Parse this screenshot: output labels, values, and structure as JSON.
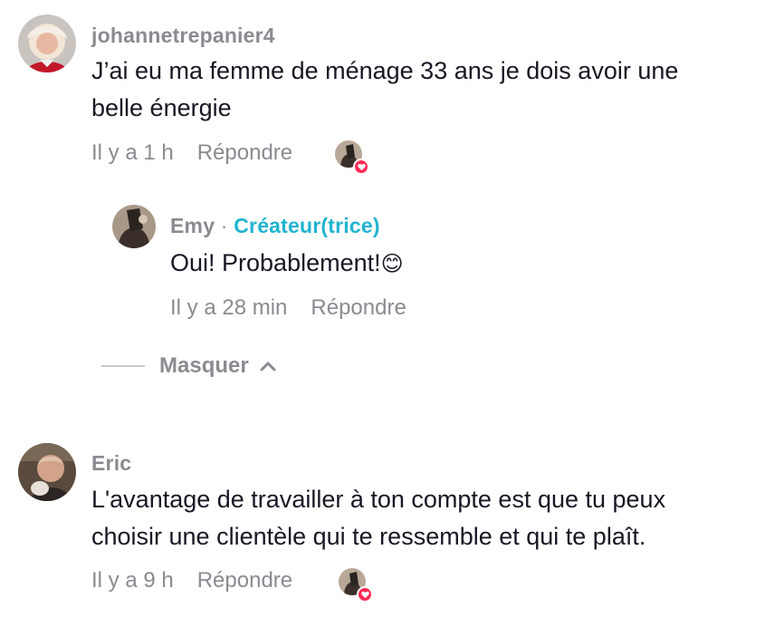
{
  "comments": [
    {
      "username": "johannetrepanier4",
      "text_line1": "J’ai eu ma femme de ménage 33 ans je dois avoir une",
      "text_line2": "belle énergie",
      "time": "Il y a 1 h",
      "reply_label": "Répondre",
      "reply": {
        "username": "Emy",
        "separator": "·",
        "creator_label": "Créateur(trice)",
        "text": "Oui! Probablement!",
        "emoji": "😊",
        "time": "Il y a 28 min",
        "reply_label": "Répondre"
      }
    },
    {
      "username": "Eric",
      "text_line1": "L'avantage de travailler à ton compte est que tu peux",
      "text_line2": "choisir une clientèle qui te ressemble et qui te plaît.",
      "time": "Il y a 9 h",
      "reply_label": "Répondre"
    }
  ],
  "thread_toggle": {
    "label": "Masquer"
  },
  "colors": {
    "creator_accent": "#20b4cf",
    "like_heart": "#fe2c55",
    "muted_text": "#8a8b91"
  }
}
